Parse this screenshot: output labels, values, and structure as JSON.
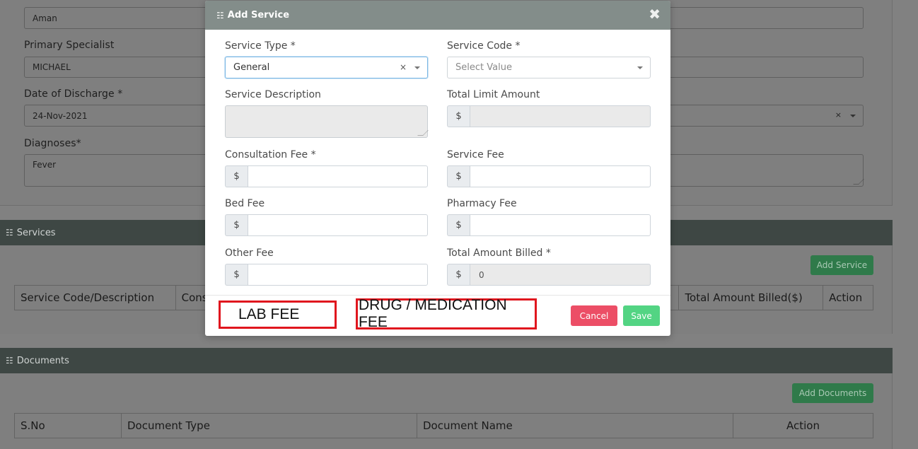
{
  "background": {
    "fields": {
      "name_value": "Aman",
      "primary_specialist_label": "Primary Specialist",
      "primary_specialist_value": "MICHAEL",
      "discharge_label": "Date of Discharge *",
      "discharge_value": "24-Nov-2021",
      "diagnoses_label": "Diagnoses*",
      "diagnoses_value": "Fever"
    },
    "services": {
      "title": "Services",
      "add_button": "Add Service",
      "columns": [
        "Service Code/Description",
        "Cons",
        "Total Amount Billed($)",
        "Action"
      ]
    },
    "documents": {
      "title": "Documents",
      "add_button": "Add Documents",
      "columns": [
        "S.No",
        "Document Type",
        "Document Name",
        "Action"
      ]
    }
  },
  "modal": {
    "title": "Add Service",
    "close_glyph": "✖",
    "service_type": {
      "label": "Service Type *",
      "value": "General",
      "clear": "×"
    },
    "service_code": {
      "label": "Service Code *",
      "placeholder": "Select Value"
    },
    "service_description": {
      "label": "Service Description"
    },
    "total_limit_amount": {
      "label": "Total Limit Amount",
      "currency": "$"
    },
    "consultation_fee": {
      "label": "Consultation Fee *",
      "currency": "$"
    },
    "service_fee": {
      "label": "Service Fee",
      "currency": "$"
    },
    "bed_fee": {
      "label": "Bed Fee",
      "currency": "$"
    },
    "pharmacy_fee": {
      "label": "Pharmacy Fee",
      "currency": "$"
    },
    "other_fee": {
      "label": "Other Fee",
      "currency": "$"
    },
    "total_amount_billed": {
      "label": "Total Amount Billed *",
      "currency": "$",
      "value": "0"
    },
    "annotations": {
      "lab_fee": "LAB FEE",
      "drug_fee": "DRUG / MEDICATION FEE"
    },
    "cancel_label": "Cancel",
    "save_label": "Save"
  },
  "colors": {
    "header_bg": "#838d8a",
    "section_bar": "#3e4744",
    "cancel": "#ec4e66",
    "save": "#53d483",
    "annotation_border": "#e0161e",
    "add_button": "#2f7a4a"
  },
  "icons": {
    "list": "list-icon",
    "close": "close-icon"
  }
}
